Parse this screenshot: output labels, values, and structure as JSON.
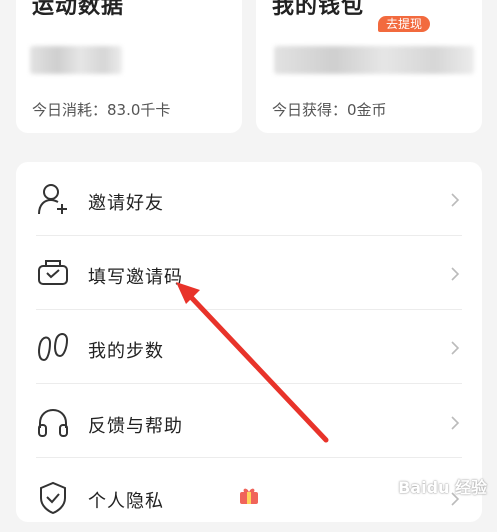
{
  "cards": {
    "sport": {
      "title": "运动数据",
      "stat": "今日消耗：83.0千卡"
    },
    "wallet": {
      "title": "我的钱包",
      "badge": "去提现",
      "stat": "今日获得：0金币"
    }
  },
  "menu": [
    {
      "label": "邀请好友",
      "icon": "invite-friend-icon"
    },
    {
      "label": "填写邀请码",
      "icon": "invite-code-icon"
    },
    {
      "label": "我的步数",
      "icon": "footprints-icon"
    },
    {
      "label": "反馈与帮助",
      "icon": "headphones-icon"
    },
    {
      "label": "个人隐私",
      "icon": "shield-icon"
    }
  ],
  "watermark": "Baidu 经验",
  "colors": {
    "accent": "#f26a3e",
    "arrow": "#e8332a",
    "background": "#f4f4f4"
  }
}
